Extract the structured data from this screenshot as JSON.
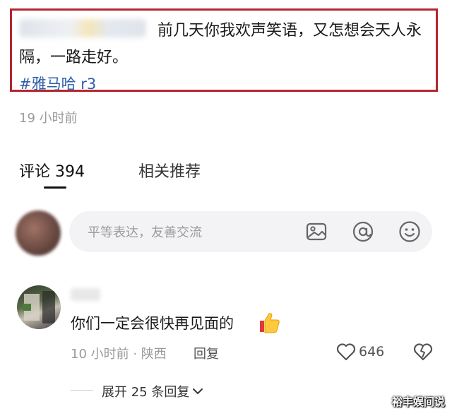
{
  "post": {
    "text": "前几天你我欢声笑语，又怎想会天人永隔，一路走好。",
    "topic": "#雅马哈 r3",
    "time": "19 小时前"
  },
  "tabs": [
    {
      "label": "评论 394",
      "active": true
    },
    {
      "label": "相关推荐",
      "active": false
    }
  ],
  "input": {
    "placeholder": "平等表达，友善交流",
    "icons": [
      "image-icon",
      "at-icon",
      "emoji-icon"
    ]
  },
  "comment": {
    "text": "你们一定会很快再见面的",
    "meta": "10 小时前 · 陕西",
    "reply_label": "回复",
    "like_count": "646"
  },
  "expand_label": "展开 25 条回复",
  "watermark": "裕丰娱间说",
  "colors": {
    "border": "#b3262e",
    "topic": "#2b5ea8",
    "input_bg": "#f3f3f5"
  }
}
